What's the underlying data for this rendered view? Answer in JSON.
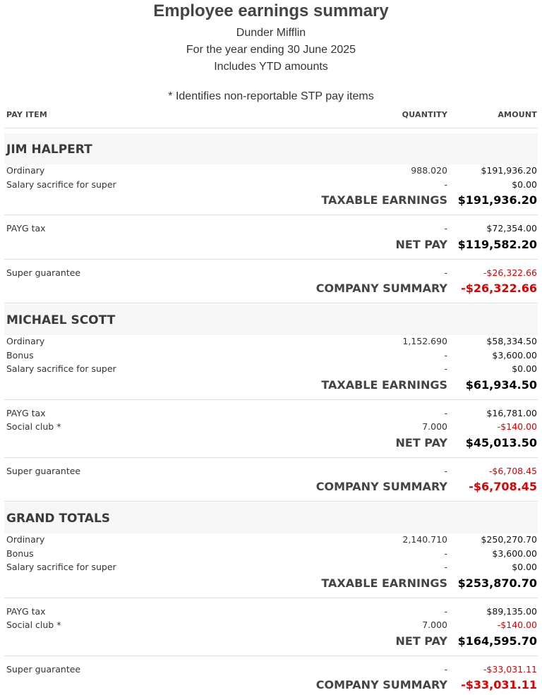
{
  "header": {
    "title": "Employee earnings summary",
    "company": "Dunder Mifflin",
    "period": "For the year ending 30 June 2025",
    "ytd_note": "Includes YTD amounts",
    "stp_note": "* Identifies non-reportable STP pay items"
  },
  "columns": {
    "item": "PAY ITEM",
    "quantity": "QUANTITY",
    "amount": "AMOUNT"
  },
  "sections": [
    {
      "title": "JIM HALPERT",
      "blocks": [
        {
          "rows": [
            {
              "name": "Ordinary",
              "qty": "988.020",
              "amount": "$191,936.20",
              "negative": false
            },
            {
              "name": "Salary sacrifice for super",
              "qty": "-",
              "amount": "$0.00",
              "negative": false
            }
          ],
          "total_label": "TAXABLE EARNINGS",
          "total_value": "$191,936.20",
          "total_negative": false
        },
        {
          "rows": [
            {
              "name": "PAYG tax",
              "qty": "-",
              "amount": "$72,354.00",
              "negative": false
            }
          ],
          "total_label": "NET PAY",
          "total_value": "$119,582.20",
          "total_negative": false
        },
        {
          "rows": [
            {
              "name": "Super guarantee",
              "qty": "-",
              "amount": "-$26,322.66",
              "negative": true
            }
          ],
          "total_label": "COMPANY SUMMARY",
          "total_value": "-$26,322.66",
          "total_negative": true
        }
      ]
    },
    {
      "title": "MICHAEL SCOTT",
      "blocks": [
        {
          "rows": [
            {
              "name": "Ordinary",
              "qty": "1,152.690",
              "amount": "$58,334.50",
              "negative": false
            },
            {
              "name": "Bonus",
              "qty": "-",
              "amount": "$3,600.00",
              "negative": false
            },
            {
              "name": "Salary sacrifice for super",
              "qty": "-",
              "amount": "$0.00",
              "negative": false
            }
          ],
          "total_label": "TAXABLE EARNINGS",
          "total_value": "$61,934.50",
          "total_negative": false
        },
        {
          "rows": [
            {
              "name": "PAYG tax",
              "qty": "-",
              "amount": "$16,781.00",
              "negative": false
            },
            {
              "name": "Social club *",
              "qty": "7.000",
              "amount": "-$140.00",
              "negative": true
            }
          ],
          "total_label": "NET PAY",
          "total_value": "$45,013.50",
          "total_negative": false
        },
        {
          "rows": [
            {
              "name": "Super guarantee",
              "qty": "-",
              "amount": "-$6,708.45",
              "negative": true
            }
          ],
          "total_label": "COMPANY SUMMARY",
          "total_value": "-$6,708.45",
          "total_negative": true
        }
      ]
    },
    {
      "title": "GRAND TOTALS",
      "blocks": [
        {
          "rows": [
            {
              "name": "Ordinary",
              "qty": "2,140.710",
              "amount": "$250,270.70",
              "negative": false
            },
            {
              "name": "Bonus",
              "qty": "-",
              "amount": "$3,600.00",
              "negative": false
            },
            {
              "name": "Salary sacrifice for super",
              "qty": "-",
              "amount": "$0.00",
              "negative": false
            }
          ],
          "total_label": "TAXABLE EARNINGS",
          "total_value": "$253,870.70",
          "total_negative": false
        },
        {
          "rows": [
            {
              "name": "PAYG tax",
              "qty": "-",
              "amount": "$89,135.00",
              "negative": false
            },
            {
              "name": "Social club *",
              "qty": "7.000",
              "amount": "-$140.00",
              "negative": true
            }
          ],
          "total_label": "NET PAY",
          "total_value": "$164,595.70",
          "total_negative": false
        },
        {
          "rows": [
            {
              "name": "Super guarantee",
              "qty": "-",
              "amount": "-$33,031.11",
              "negative": true
            }
          ],
          "total_label": "COMPANY SUMMARY",
          "total_value": "-$33,031.11",
          "total_negative": true
        }
      ]
    }
  ],
  "colors": {
    "negative": "#e00000",
    "section_bg": "#f5f6f5",
    "divider": "#dedede"
  }
}
